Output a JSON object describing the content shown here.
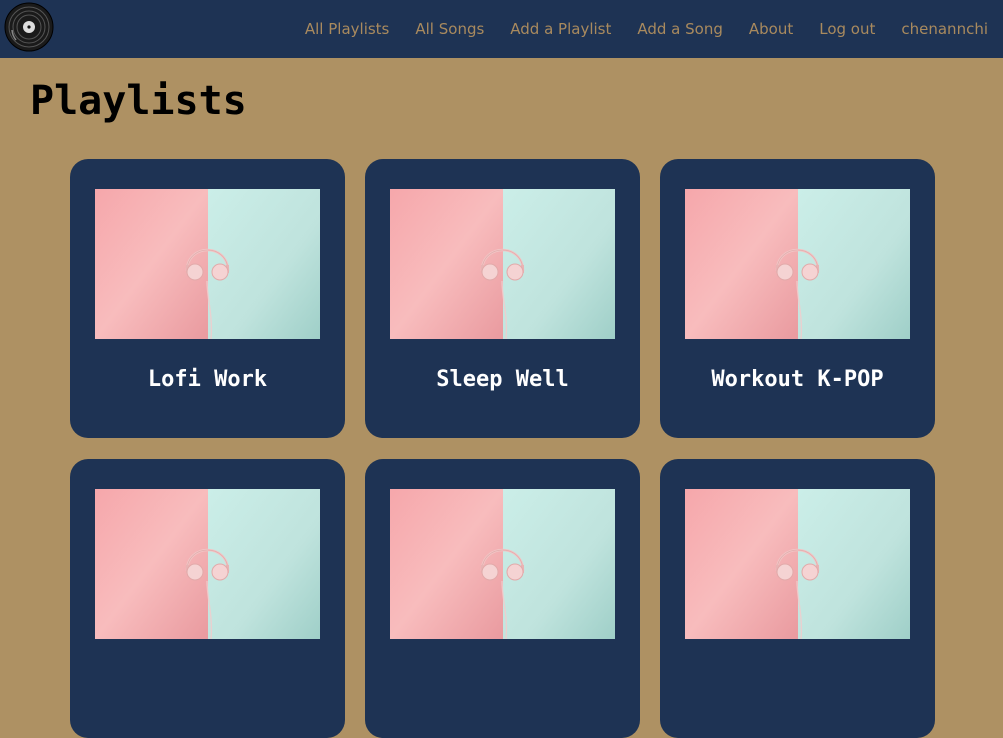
{
  "nav": {
    "logo_icon": "vinyl-record-icon",
    "links": [
      {
        "label": "All Playlists"
      },
      {
        "label": "All Songs"
      },
      {
        "label": "Add a Playlist"
      },
      {
        "label": "Add a Song"
      },
      {
        "label": "About"
      },
      {
        "label": "Log out"
      },
      {
        "label": "chenannchi"
      }
    ],
    "link_color": "#a98a5e",
    "background": "#1e3354"
  },
  "page": {
    "title": "Playlists",
    "background": "#ae9163"
  },
  "playlists": [
    {
      "title": "Lofi Work",
      "image_icon": "headphones-cover-image"
    },
    {
      "title": "Sleep Well",
      "image_icon": "headphones-cover-image"
    },
    {
      "title": "Workout K-POP",
      "image_icon": "headphones-cover-image"
    },
    {
      "title": "",
      "image_icon": "headphones-cover-image"
    },
    {
      "title": "",
      "image_icon": "headphones-cover-image"
    },
    {
      "title": "",
      "image_icon": "headphones-cover-image"
    }
  ],
  "colors": {
    "card_bg": "#1e3354",
    "cover_pink": "#f4b7b7",
    "cover_mint": "#bfe3dd"
  }
}
